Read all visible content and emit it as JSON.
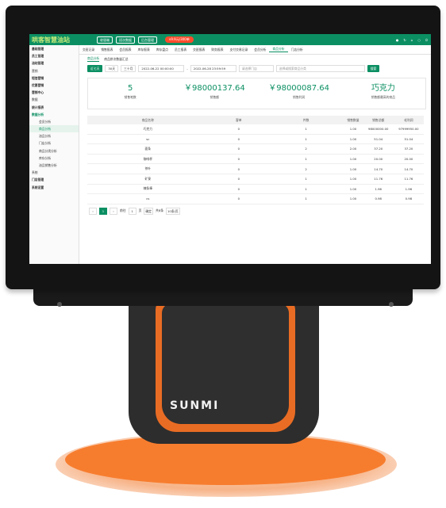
{
  "device": {
    "brand": "SUNMI"
  },
  "header": {
    "logo": "哄客智慧油站",
    "buttons": [
      "收银端",
      "班次数据",
      "后台管理"
    ],
    "promo": "v9.9元/300单",
    "right_icons": [
      "user-icon",
      "refresh-icon",
      "home-icon",
      "bell-icon",
      "power-icon"
    ]
  },
  "sidebar": {
    "items": [
      {
        "label": "基础管理",
        "kind": "grp-arrow"
      },
      {
        "label": "员工管理",
        "kind": "grp-arrow"
      },
      {
        "label": "油站管理",
        "kind": "grp"
      },
      {
        "label": "营销",
        "kind": "plain"
      },
      {
        "label": "短信营销",
        "kind": "grp"
      },
      {
        "label": "优惠营销",
        "kind": "grp"
      },
      {
        "label": "营销中心",
        "kind": "grp"
      },
      {
        "label": "数据",
        "kind": "plain"
      },
      {
        "label": "统计报表",
        "kind": "grp-arrow"
      },
      {
        "label": "数据分析",
        "kind": "open"
      },
      {
        "label": "会员分析",
        "kind": "sub"
      },
      {
        "label": "商品分析",
        "kind": "sub-act"
      },
      {
        "label": "油品分析",
        "kind": "sub"
      },
      {
        "label": "门店分析",
        "kind": "sub"
      },
      {
        "label": "商品分类分析",
        "kind": "sub"
      },
      {
        "label": "库存分析",
        "kind": "sub"
      },
      {
        "label": "油品销售分析",
        "kind": "sub"
      },
      {
        "label": "系统",
        "kind": "plain"
      },
      {
        "label": "门店管理",
        "kind": "grp-arrow"
      },
      {
        "label": "系统设置",
        "kind": "grp-arrow"
      }
    ]
  },
  "tabs": [
    "交班记录",
    "销售报表",
    "会员报表",
    "库存报表",
    "库存盘点",
    "员工报表",
    "交班报表",
    "财务报表",
    "支付交易记录",
    "会员分析",
    "商品分析",
    "门店分析"
  ],
  "subtabs": [
    "商品分析",
    "商品拼次数量汇总"
  ],
  "filters": {
    "periods": [
      "近七天",
      "30天",
      "三十月"
    ],
    "start": "2022-06-22 00:00:00",
    "end": "2022-06-28 23:59:59",
    "store_placeholder": "请选择门店",
    "product_placeholder": "选择或搜索商品分类",
    "search_label": "搜索"
  },
  "stats": [
    {
      "value": "5",
      "label": "销售笔数"
    },
    {
      "value": "￥98000137.64",
      "label": "销售额"
    },
    {
      "value": "￥98000087.64",
      "label": "销售利润"
    },
    {
      "value": "巧克力",
      "label": "销售额最高的商品"
    }
  ],
  "table": {
    "headers": [
      "商品名称",
      "客单",
      "件数",
      "销售数量",
      "销售总额",
      "毛利润"
    ],
    "rows": [
      [
        "巧克力",
        "0",
        "1",
        "1.00",
        "98000000.00",
        "97999950.00"
      ],
      [
        "sc",
        "0",
        "1",
        "1.00",
        "51.04",
        "51.04"
      ],
      [
        "面条",
        "0",
        "2",
        "2.00",
        "37.20",
        "37.20"
      ],
      [
        "咖啡杯",
        "0",
        "1",
        "1.00",
        "20.00",
        "20.00"
      ],
      [
        "茶叶",
        "0",
        "2",
        "1.00",
        "14.70",
        "14.70"
      ],
      [
        "矿泉",
        "0",
        "1",
        "1.00",
        "11.76",
        "11.76"
      ],
      [
        "辣条棒",
        "0",
        "1",
        "1.00",
        "1.96",
        "1.96"
      ],
      [
        "cs",
        "0",
        "1",
        "1.00",
        "0.98",
        "0.98"
      ]
    ]
  },
  "pager": {
    "current": "1",
    "goto": "前往",
    "page": "1",
    "unit": "页",
    "confirm": "确定",
    "total": "共8条",
    "size": "10条/页"
  }
}
